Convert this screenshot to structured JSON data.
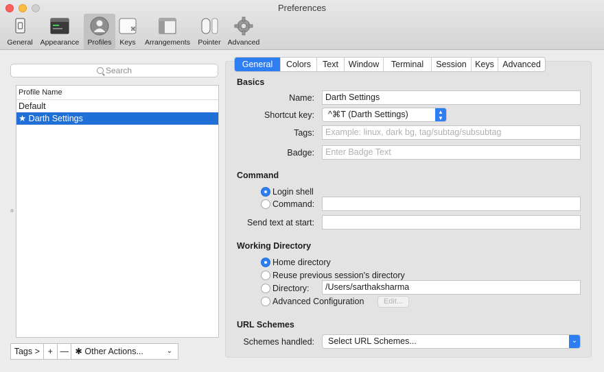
{
  "window": {
    "title": "Preferences"
  },
  "toolbar": [
    {
      "label": "General",
      "icon": "switch-icon"
    },
    {
      "label": "Appearance",
      "icon": "window-appearance-icon"
    },
    {
      "label": "Profiles",
      "icon": "person-icon"
    },
    {
      "label": "Keys",
      "icon": "command-key-icon"
    },
    {
      "label": "Arrangements",
      "icon": "window-arrangement-icon"
    },
    {
      "label": "Pointer",
      "icon": "mouse-icon"
    },
    {
      "label": "Advanced",
      "icon": "gear-icon"
    }
  ],
  "search": {
    "placeholder": "Search"
  },
  "profiles": {
    "header": "Profile Name",
    "items": [
      "Default",
      "★ Darth Settings"
    ]
  },
  "bottom": {
    "tags": "Tags >",
    "add": "+",
    "remove": "—",
    "other_actions": "Other Actions..."
  },
  "tabs": [
    "General",
    "Colors",
    "Text",
    "Window",
    "Terminal",
    "Session",
    "Keys",
    "Advanced"
  ],
  "basics": {
    "title": "Basics",
    "name_label": "Name:",
    "name_value": "Darth Settings",
    "shortcut_label": "Shortcut key:",
    "shortcut_value": "^⌘T (Darth Settings)",
    "tags_label": "Tags:",
    "tags_placeholder": "Example: linux, dark bg, tag/subtag/subsubtag",
    "badge_label": "Badge:",
    "badge_placeholder": "Enter Badge Text"
  },
  "command": {
    "title": "Command",
    "login_shell": "Login shell",
    "command_label": "Command:",
    "send_text_label": "Send text at start:"
  },
  "working_directory": {
    "title": "Working Directory",
    "home": "Home directory",
    "reuse": "Reuse previous session's directory",
    "directory_label": "Directory:",
    "directory_value": "/Users/sarthaksharma",
    "advanced": "Advanced Configuration",
    "edit": "Edit..."
  },
  "url_schemes": {
    "title": "URL Schemes",
    "label": "Schemes handled:",
    "value": "Select URL Schemes..."
  },
  "colors": {
    "accent": "#2d7ef3",
    "selection": "#1f6fd6",
    "close": "#fc605c",
    "minimize": "#fdbc40"
  }
}
